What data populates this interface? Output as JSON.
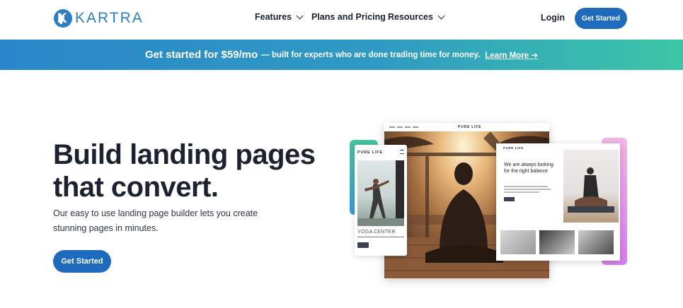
{
  "brand": {
    "logo_text": "KARTRA",
    "logo_letter": "K"
  },
  "nav": {
    "items": [
      {
        "label": "Features",
        "has_dropdown": true
      },
      {
        "label": "Plans and Pricing",
        "has_dropdown": false
      },
      {
        "label": "Resources",
        "has_dropdown": true
      }
    ],
    "login": "Login",
    "cta": "Get Started"
  },
  "banner": {
    "strong": "Get started for $59/mo",
    "rest": "— built for experts who are done trading time for money.",
    "link": "Learn More ➔"
  },
  "hero": {
    "title": "Build landing pages that convert.",
    "subtitle": "Our easy to use landing page builder lets you create stunning pages in minutes.",
    "cta": "Get Started"
  },
  "mockup": {
    "left_brand": "PURE LIFE",
    "left_caption": "YOGA CENTER",
    "center_brand": "PURE LIFE",
    "right_brand": "PURE LIFE",
    "right_heading": "We are always looking for the right balance"
  },
  "colors": {
    "brand_blue": "#1e6bbd",
    "banner_start": "#2a86c9",
    "banner_end": "#3dc6a6"
  }
}
